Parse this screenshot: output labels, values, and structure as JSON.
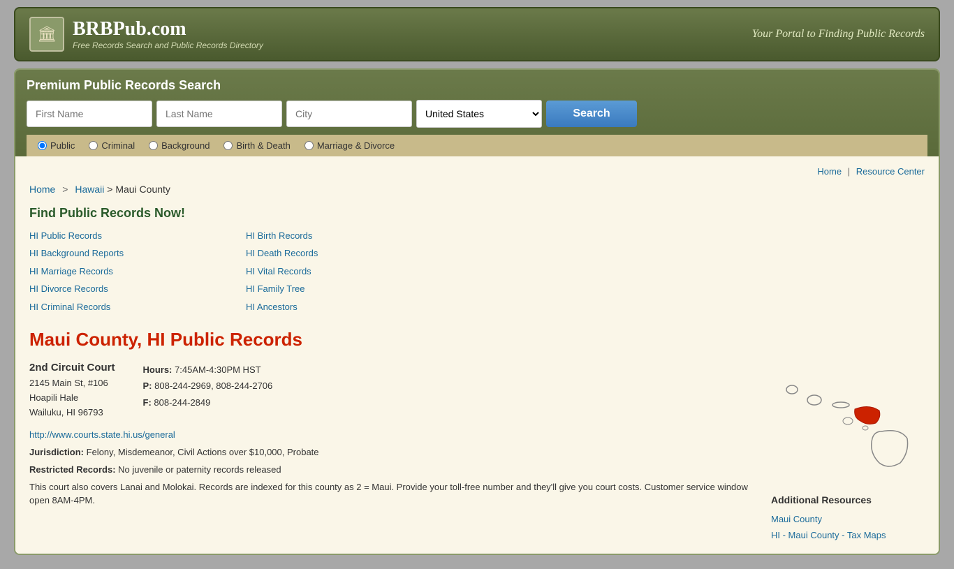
{
  "header": {
    "logo_icon": "🏛",
    "site_title": "BRBPub.com",
    "site_subtitle": "Free Records Search and Public Records Directory",
    "tagline": "Your Portal to Finding Public Records"
  },
  "search_section": {
    "title": "Premium Public Records Search",
    "first_name_placeholder": "First Name",
    "last_name_placeholder": "Last Name",
    "city_placeholder": "City",
    "country_value": "United States",
    "search_button_label": "Search",
    "options": [
      {
        "id": "opt-public",
        "label": "Public",
        "checked": true
      },
      {
        "id": "opt-criminal",
        "label": "Criminal",
        "checked": false
      },
      {
        "id": "opt-background",
        "label": "Background",
        "checked": false
      },
      {
        "id": "opt-birth-death",
        "label": "Birth & Death",
        "checked": false
      },
      {
        "id": "opt-marriage-divorce",
        "label": "Marriage & Divorce",
        "checked": false
      }
    ]
  },
  "top_nav": {
    "home_label": "Home",
    "separator": "|",
    "resource_center_label": "Resource Center"
  },
  "breadcrumb": {
    "home": "Home",
    "state": "Hawaii",
    "county": "Maui County"
  },
  "find_records": {
    "title": "Find Public Records Now!",
    "links": [
      {
        "label": "HI Public Records",
        "col": 1
      },
      {
        "label": "HI Birth Records",
        "col": 2
      },
      {
        "label": "HI Background Reports",
        "col": 1
      },
      {
        "label": "HI Death Records",
        "col": 2
      },
      {
        "label": "HI Marriage Records",
        "col": 1
      },
      {
        "label": "HI Vital Records",
        "col": 2
      },
      {
        "label": "HI Divorce Records",
        "col": 1
      },
      {
        "label": "HI Family Tree",
        "col": 2
      },
      {
        "label": "HI Criminal Records",
        "col": 1
      },
      {
        "label": "HI Ancestors",
        "col": 2
      }
    ]
  },
  "page_title": "Maui County, HI Public Records",
  "court": {
    "name": "2nd Circuit Court",
    "address_line1": "2145 Main St, #106",
    "address_line2": "Hoapili Hale",
    "address_line3": "Wailuku, HI 96793",
    "website": "http://www.courts.state.hi.us/general",
    "hours_label": "Hours:",
    "hours_value": "7:45AM-4:30PM HST",
    "phone_label": "P:",
    "phone_value": "808-244-2969, 808-244-2706",
    "fax_label": "F:",
    "fax_value": "808-244-2849",
    "jurisdiction_label": "Jurisdiction:",
    "jurisdiction_value": "Felony, Misdemeanor, Civil Actions over $10,000, Probate",
    "restricted_label": "Restricted Records:",
    "restricted_value": "No juvenile or paternity records released",
    "note": "This court also covers Lanai and Molokai. Records are indexed for this county as 2 = Maui. Provide your toll-free number and they'll give you court costs. Customer service window open 8AM-4PM."
  },
  "additional_resources": {
    "title": "Additional Resources",
    "links": [
      {
        "label": "Maui County"
      },
      {
        "label": "HI - Maui County - Tax Maps"
      }
    ]
  }
}
